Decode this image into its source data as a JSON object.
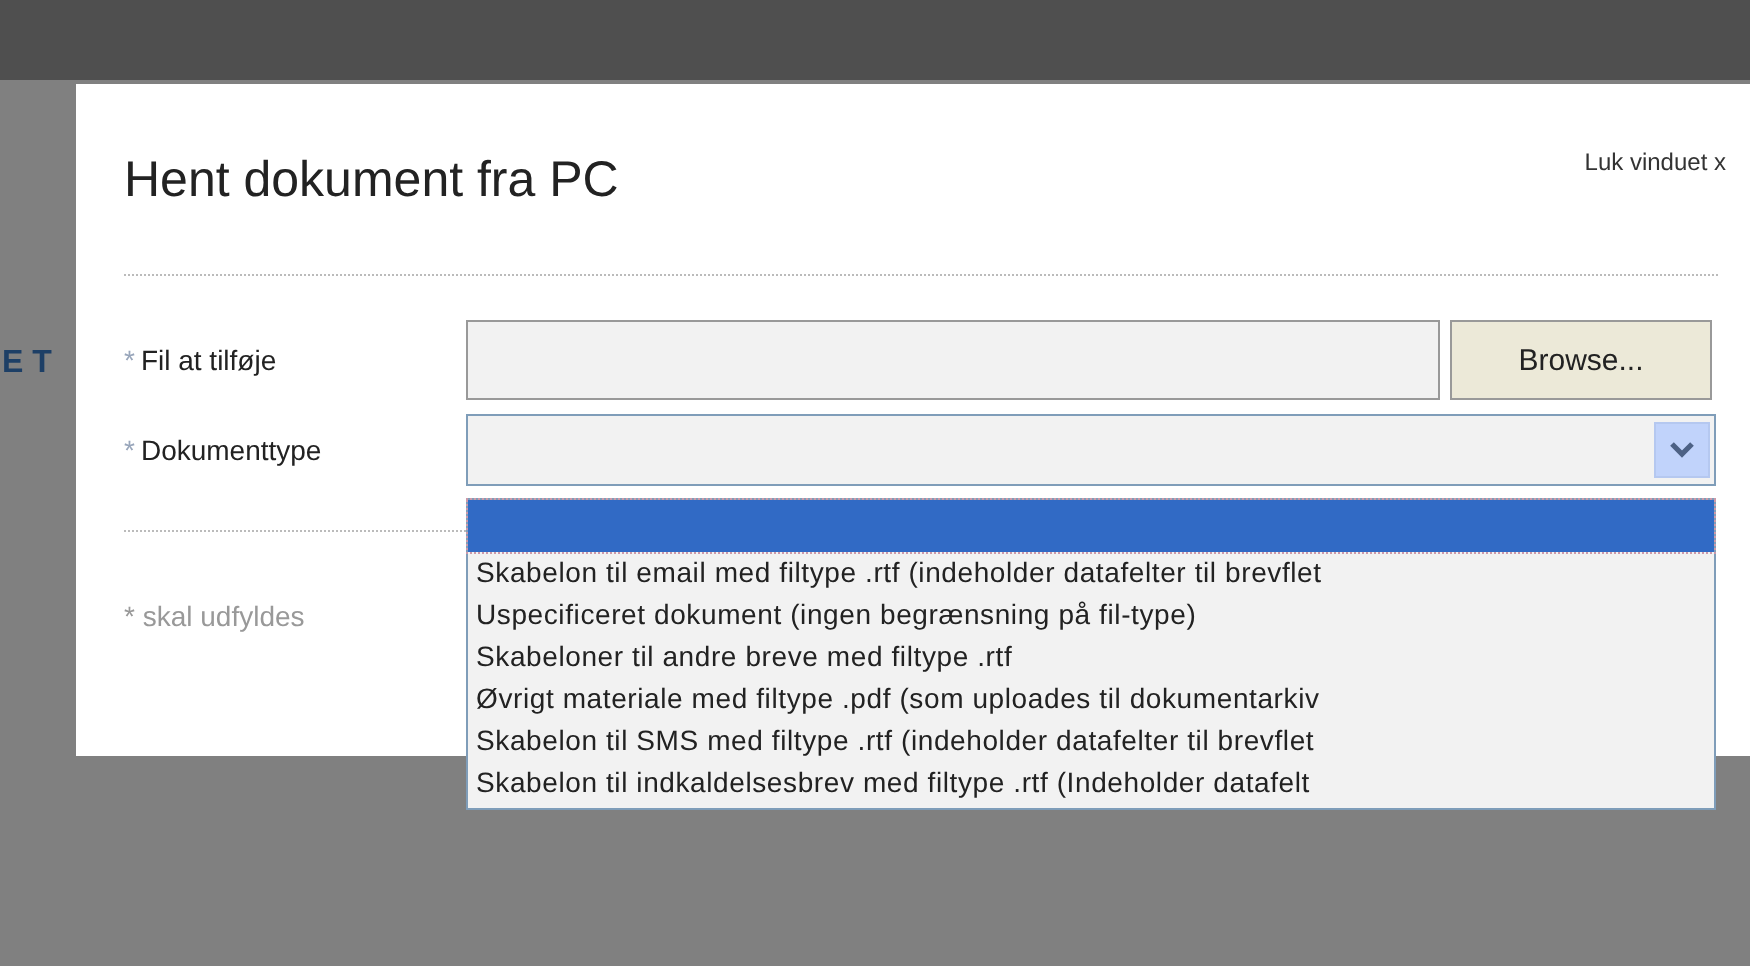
{
  "background": {
    "heading_fragment": "E T"
  },
  "dialog": {
    "title": "Hent dokument fra PC",
    "close_link": "Luk vinduet x",
    "fields": [
      {
        "kind": "file",
        "mark": "*",
        "label": "Fil at tilføje",
        "button": "Browse..."
      },
      {
        "kind": "select",
        "mark": "*",
        "label": "Dokumenttype",
        "expanded": true,
        "options": [
          {
            "selected": true
          },
          {
            "label": "Skabelon til email med filtype .rtf (indeholder datafelter til brevflet",
            "selected": false
          },
          {
            "label": "Uspecificeret dokument (ingen begrænsning på fil-type)",
            "selected": false
          },
          {
            "label": "Skabeloner til andre breve med filtype .rtf",
            "selected": false
          },
          {
            "label": "Øvrigt materiale med filtype .pdf (som uploades til dokumentarkiv",
            "selected": false
          },
          {
            "label": "Skabelon til SMS med filtype .rtf (indeholder datafelter til brevflet",
            "selected": false
          },
          {
            "label": "Skabelon til indkaldelsesbrev med filtype .rtf (Indeholder datafelt",
            "selected": false
          }
        ]
      }
    ],
    "footnote": "* skal udfyldes"
  }
}
